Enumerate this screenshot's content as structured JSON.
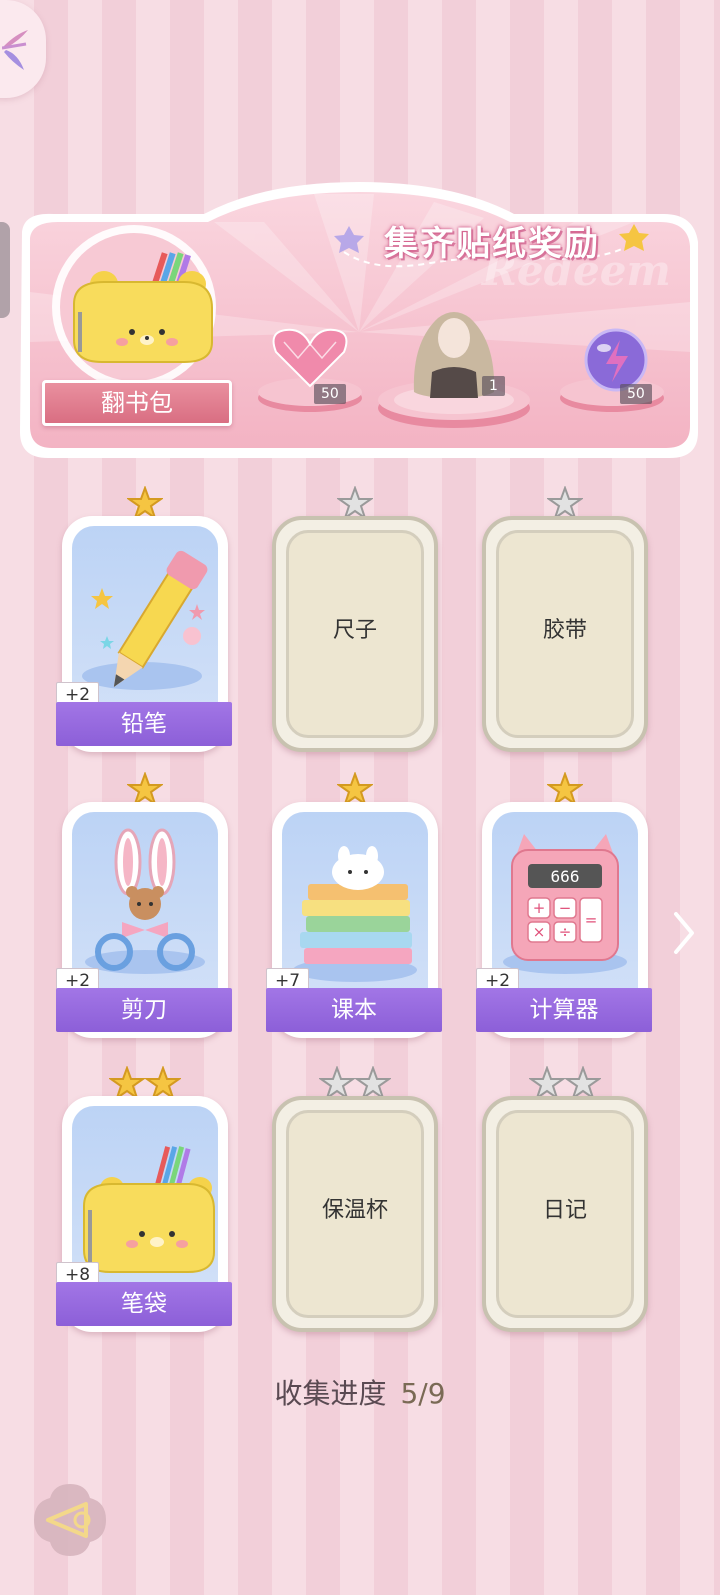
{
  "banner": {
    "title": "集齐贴纸奖励",
    "watermark": "Redeem",
    "bag_label": "翻书包",
    "rewards": [
      {
        "icon": "pink-heart-gem-icon",
        "count": "50"
      },
      {
        "icon": "character-avatar-icon",
        "count": "1"
      },
      {
        "icon": "purple-energy-orb-icon",
        "count": "50"
      }
    ]
  },
  "cards": [
    {
      "name": "铅笔",
      "collected": true,
      "plus": "+2",
      "stars": 1,
      "icon": "pencil-icon"
    },
    {
      "name": "尺子",
      "collected": false,
      "stars": 1
    },
    {
      "name": "胶带",
      "collected": false,
      "stars": 1
    },
    {
      "name": "剪刀",
      "collected": true,
      "plus": "+2",
      "stars": 1,
      "icon": "scissors-icon"
    },
    {
      "name": "课本",
      "collected": true,
      "plus": "+7",
      "stars": 1,
      "icon": "textbooks-icon"
    },
    {
      "name": "计算器",
      "collected": true,
      "plus": "+2",
      "stars": 1,
      "icon": "calculator-icon",
      "display": "666"
    },
    {
      "name": "笔袋",
      "collected": true,
      "plus": "+8",
      "stars": 2,
      "icon": "pencil-case-icon"
    },
    {
      "name": "保温杯",
      "collected": false,
      "stars": 2
    },
    {
      "name": "日记",
      "collected": false,
      "stars": 2
    }
  ],
  "progress": {
    "label": "收集进度",
    "value": "5/9"
  },
  "colors": {
    "accent_purple": "#9a6ae0",
    "banner_pink": "#f4b8c8",
    "star_gold": "#f5c542"
  }
}
